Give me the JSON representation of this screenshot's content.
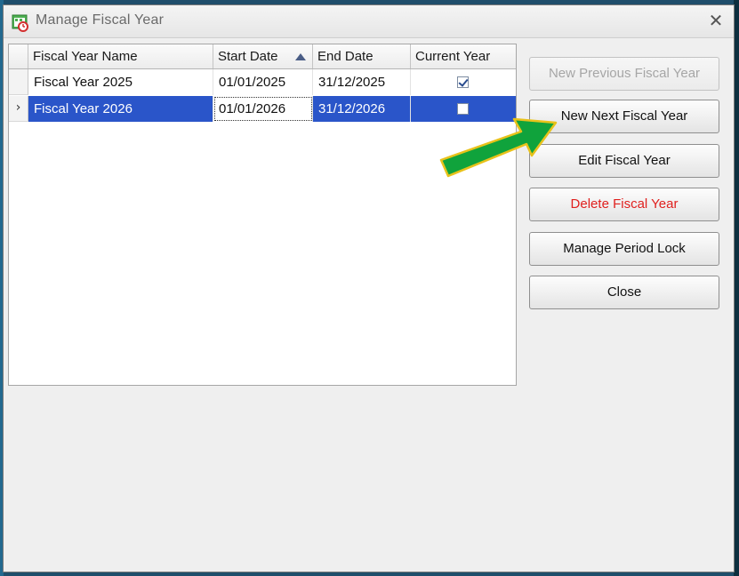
{
  "window": {
    "title": "Manage Fiscal Year"
  },
  "grid": {
    "columns": [
      "Fiscal Year Name",
      "Start Date",
      "End Date",
      "Current Year"
    ],
    "rows": [
      {
        "name": "Fiscal Year 2025",
        "start": "01/01/2025",
        "end": "31/12/2025",
        "current": true
      },
      {
        "name": "Fiscal Year 2026",
        "start": "01/01/2026",
        "end": "31/12/2026",
        "current": false
      }
    ],
    "selected_row": 1,
    "sorted_column": "Start Date",
    "sort_direction": "ascending"
  },
  "buttons": {
    "new_previous": "New Previous Fiscal Year",
    "new_next": "New Next Fiscal Year",
    "edit": "Edit Fiscal Year",
    "delete": "Delete Fiscal Year",
    "period_lock": "Manage Period Lock",
    "close": "Close"
  },
  "colors": {
    "selection": "#2a55c9",
    "delete_text": "#e0201e",
    "annotation_arrow": "#10a33c"
  }
}
